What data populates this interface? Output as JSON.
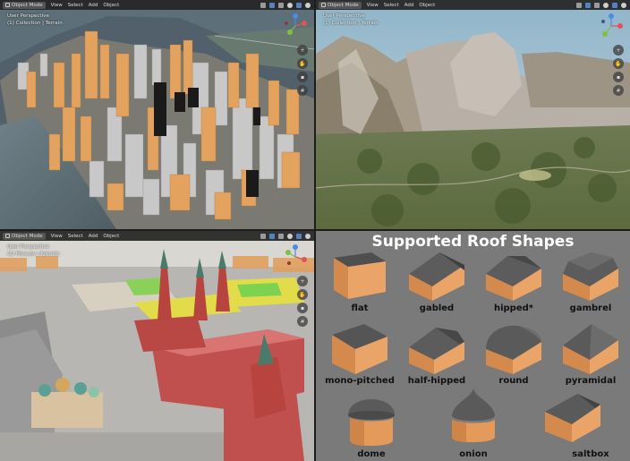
{
  "viewports": [
    {
      "id": "nyc",
      "header": {
        "mode": "Object Mode",
        "menus": [
          "View",
          "Select",
          "Add",
          "Object"
        ]
      },
      "label_line1": "User Perspective",
      "label_line2": "(1) Collection | Terrain"
    },
    {
      "id": "yosemite",
      "header": {
        "mode": "Object Mode",
        "menus": [
          "View",
          "Select",
          "Add",
          "Object"
        ]
      },
      "label_line1": "User Perspective",
      "label_line2": "(1) Collection | Terrain"
    },
    {
      "id": "moscow",
      "header": {
        "mode": "Object Mode",
        "menus": [
          "View",
          "Select",
          "Add",
          "Object"
        ]
      },
      "label_line1": "User Perspective",
      "label_line2": "(1) Moscow | Kremlin"
    }
  ],
  "roofs": {
    "title": "Supported Roof Shapes",
    "shapes": [
      {
        "label": "flat"
      },
      {
        "label": "gabled"
      },
      {
        "label": "hipped*"
      },
      {
        "label": "gambrel"
      },
      {
        "label": "mono-pitched"
      },
      {
        "label": "half-hipped"
      },
      {
        "label": "round"
      },
      {
        "label": "pyramidal"
      },
      {
        "label": "dome"
      },
      {
        "label": "onion"
      },
      {
        "label": "saltbox"
      }
    ]
  },
  "colors": {
    "wall": "#e8a066",
    "wall_shade": "#d3884f",
    "roof": "#5a5a5a",
    "roof_light": "#6e6e6e",
    "panel_bg": "#7a7a7a",
    "header_bg": "#262626"
  }
}
